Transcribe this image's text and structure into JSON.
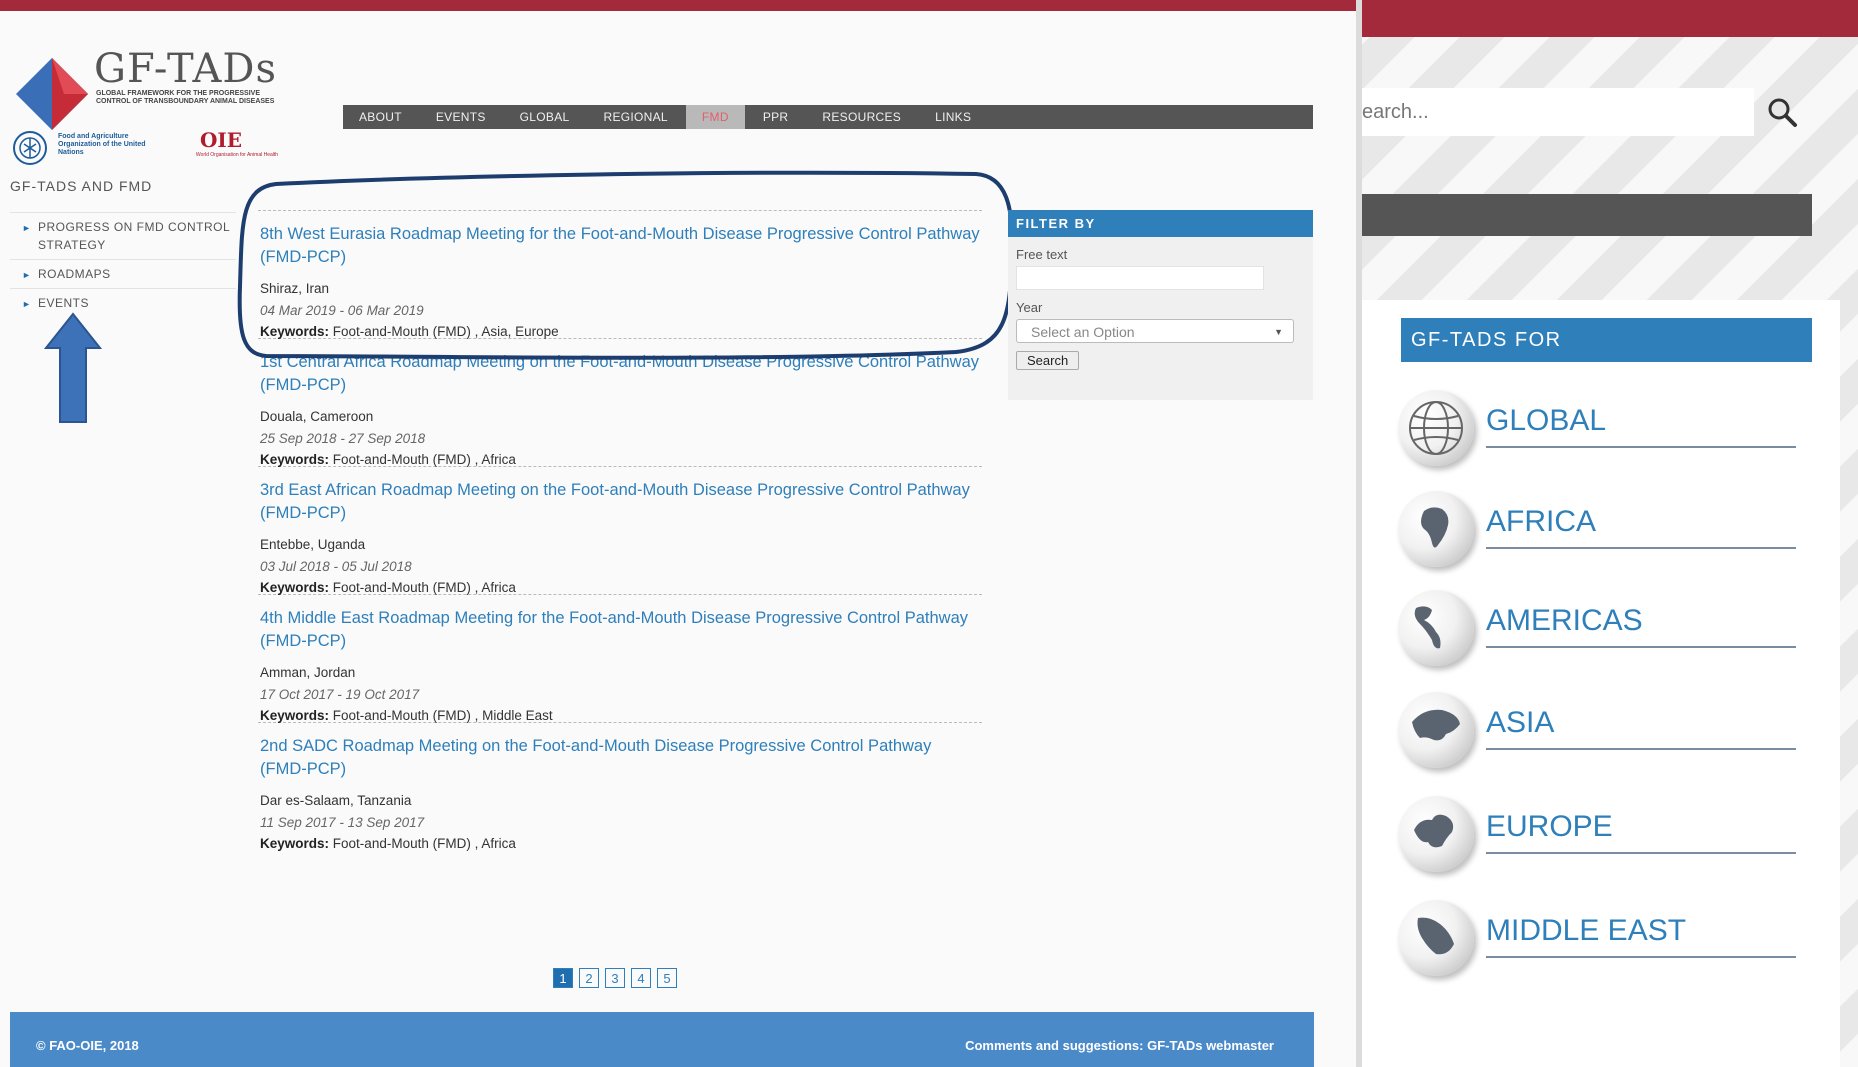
{
  "logo": {
    "title": "GF-TADs",
    "subtitle": "Global Framework for the Progressive Control of Transboundary Animal Diseases",
    "fao_text": "Food and Agriculture Organization of the United Nations",
    "oie_mark": "OIE",
    "oie_text": "World Organisation for Animal Health"
  },
  "nav": {
    "items": [
      "ABOUT",
      "EVENTS",
      "GLOBAL",
      "REGIONAL",
      "FMD",
      "PPR",
      "RESOURCES",
      "LINKS"
    ],
    "active": "FMD"
  },
  "sidebar": {
    "title": "GF-TADS AND FMD",
    "items": [
      {
        "label": "PROGRESS ON FMD CONTROL STRATEGY"
      },
      {
        "label": "ROADMAPS"
      },
      {
        "label": "EVENTS"
      }
    ]
  },
  "events": [
    {
      "title": "8th West Eurasia Roadmap Meeting for the Foot-and-Mouth Disease Progressive Control Pathway (FMD-PCP)",
      "place": "Shiraz, Iran",
      "dates": "04 Mar 2019 - 06 Mar 2019",
      "keywords_label": "Keywords:",
      "keywords": "Foot-and-Mouth (FMD) , Asia, Europe"
    },
    {
      "title": "1st Central Africa Roadmap Meeting on the Foot-and-Mouth Disease Progressive Control Pathway (FMD-PCP)",
      "place": "Douala, Cameroon",
      "dates": "25 Sep 2018 - 27 Sep 2018",
      "keywords_label": "Keywords:",
      "keywords": "Foot-and-Mouth (FMD) , Africa"
    },
    {
      "title": "3rd East African Roadmap Meeting on the Foot-and-Mouth Disease Progressive Control Pathway (FMD-PCP)",
      "place": "Entebbe, Uganda",
      "dates": "03 Jul 2018 - 05 Jul 2018",
      "keywords_label": "Keywords:",
      "keywords": "Foot-and-Mouth (FMD) , Africa"
    },
    {
      "title": "4th Middle East Roadmap Meeting for the Foot-and-Mouth Disease Progressive Control Pathway (FMD-PCP)",
      "place": "Amman, Jordan",
      "dates": "17 Oct 2017 - 19 Oct 2017",
      "keywords_label": "Keywords:",
      "keywords": "Foot-and-Mouth (FMD) , Middle East"
    },
    {
      "title": "2nd SADC Roadmap Meeting on the Foot-and-Mouth Disease Progressive Control Pathway (FMD-PCP)",
      "place": "Dar es-Salaam, Tanzania",
      "dates": "11 Sep 2017 - 13 Sep 2017",
      "keywords_label": "Keywords:",
      "keywords": "Foot-and-Mouth (FMD) , Africa"
    }
  ],
  "pager": {
    "pages": [
      "1",
      "2",
      "3",
      "4",
      "5"
    ],
    "current": "1"
  },
  "filter": {
    "heading": "FILTER BY",
    "free_text_label": "Free text",
    "free_text_value": "",
    "year_label": "Year",
    "year_placeholder": "Select an Option",
    "search_button": "Search"
  },
  "footer": {
    "copyright": "© FAO-OIE, 2018",
    "contact": "Comments and suggestions: GF-TADs webmaster"
  },
  "right": {
    "search_placeholder": "earch...",
    "for_heading": "GF-TADS FOR",
    "regions": [
      "GLOBAL",
      "AFRICA",
      "AMERICAS",
      "ASIA",
      "EUROPE",
      "MIDDLE  EAST"
    ]
  },
  "colors": {
    "brand_red": "#a32a3a",
    "link_blue": "#2e7fba",
    "footer_blue": "#4a8ac9",
    "nav_grey": "#555555"
  }
}
